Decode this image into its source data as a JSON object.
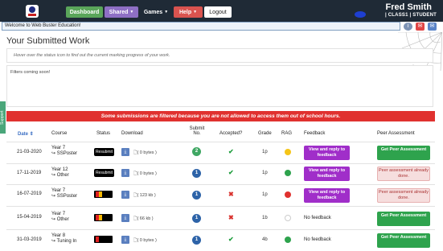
{
  "header": {
    "nav": {
      "dashboard": "Dashboard",
      "shared": "Shared",
      "games": "Games",
      "help": "Help",
      "logout": "Logout"
    },
    "user": {
      "name": "Fred Smith",
      "class_line": "| CLASS1 | STUDENT"
    },
    "welcome": "Welcome to Web Buster Education!"
  },
  "page": {
    "title": "Your Submitted Work",
    "hover_hint": "Hover over the status icon to find out the current marking progress of your work.",
    "filters_text": "Filters coming soon!",
    "side_tab": "Support",
    "alert": "Some submissions are filtered because you are not allowed to access them out of school hours."
  },
  "table": {
    "headers": {
      "date": "Date",
      "course": "Course",
      "status": "Status",
      "download": "Download",
      "submit": "Submit No.",
      "accepted": "Accepted?",
      "grade": "Grade",
      "rag": "RAG",
      "feedback": "Feedback",
      "peer": "Peer Assessment"
    },
    "rows": [
      {
        "date": "21-03-2020",
        "year": "Year 7",
        "course": "↪ SSPoster",
        "status": "Resubmit",
        "download": "( 0 bytes )",
        "submit": "2",
        "accepted": "✔",
        "grade": "1p",
        "rag": "#f5c518",
        "feedback": "View and reply to feedback",
        "peer": "Get Peer Assessment"
      },
      {
        "date": "17-11-2019",
        "year": "Year 12",
        "course": "↪ Other",
        "status": "Resubmit",
        "download": "( 0 bytes )",
        "submit": "1",
        "accepted": "✔",
        "grade": "1p",
        "rag": "#2ea34d",
        "feedback": "View and reply to feedback",
        "peer": "Peer assessment already done."
      },
      {
        "date": "16-07-2019",
        "year": "Year 7",
        "course": "↪ SSPoster",
        "status": "",
        "download": "( 123 kb )",
        "submit": "1",
        "accepted": "✖",
        "grade": "1p",
        "rag": "#e0312f",
        "feedback": "View and reply to feedback",
        "peer": "Peer assessment already done."
      },
      {
        "date": "15-04-2019",
        "year": "Year 7",
        "course": "↪ Other",
        "status": "",
        "download": "( 66 kb )",
        "submit": "1",
        "accepted": "✖",
        "grade": "1b",
        "rag": "#ffffff",
        "feedback": "No feedback",
        "peer": "Get Peer Assessment"
      },
      {
        "date": "31-03-2019",
        "year": "Year 8",
        "course": "↪ Tuning In",
        "status": "",
        "download": "( 0 bytes )",
        "submit": "1",
        "accepted": "✔",
        "grade": "4b",
        "rag": "#2ea34d",
        "feedback": "No feedback",
        "peer": "Get Peer Assessment"
      }
    ]
  }
}
